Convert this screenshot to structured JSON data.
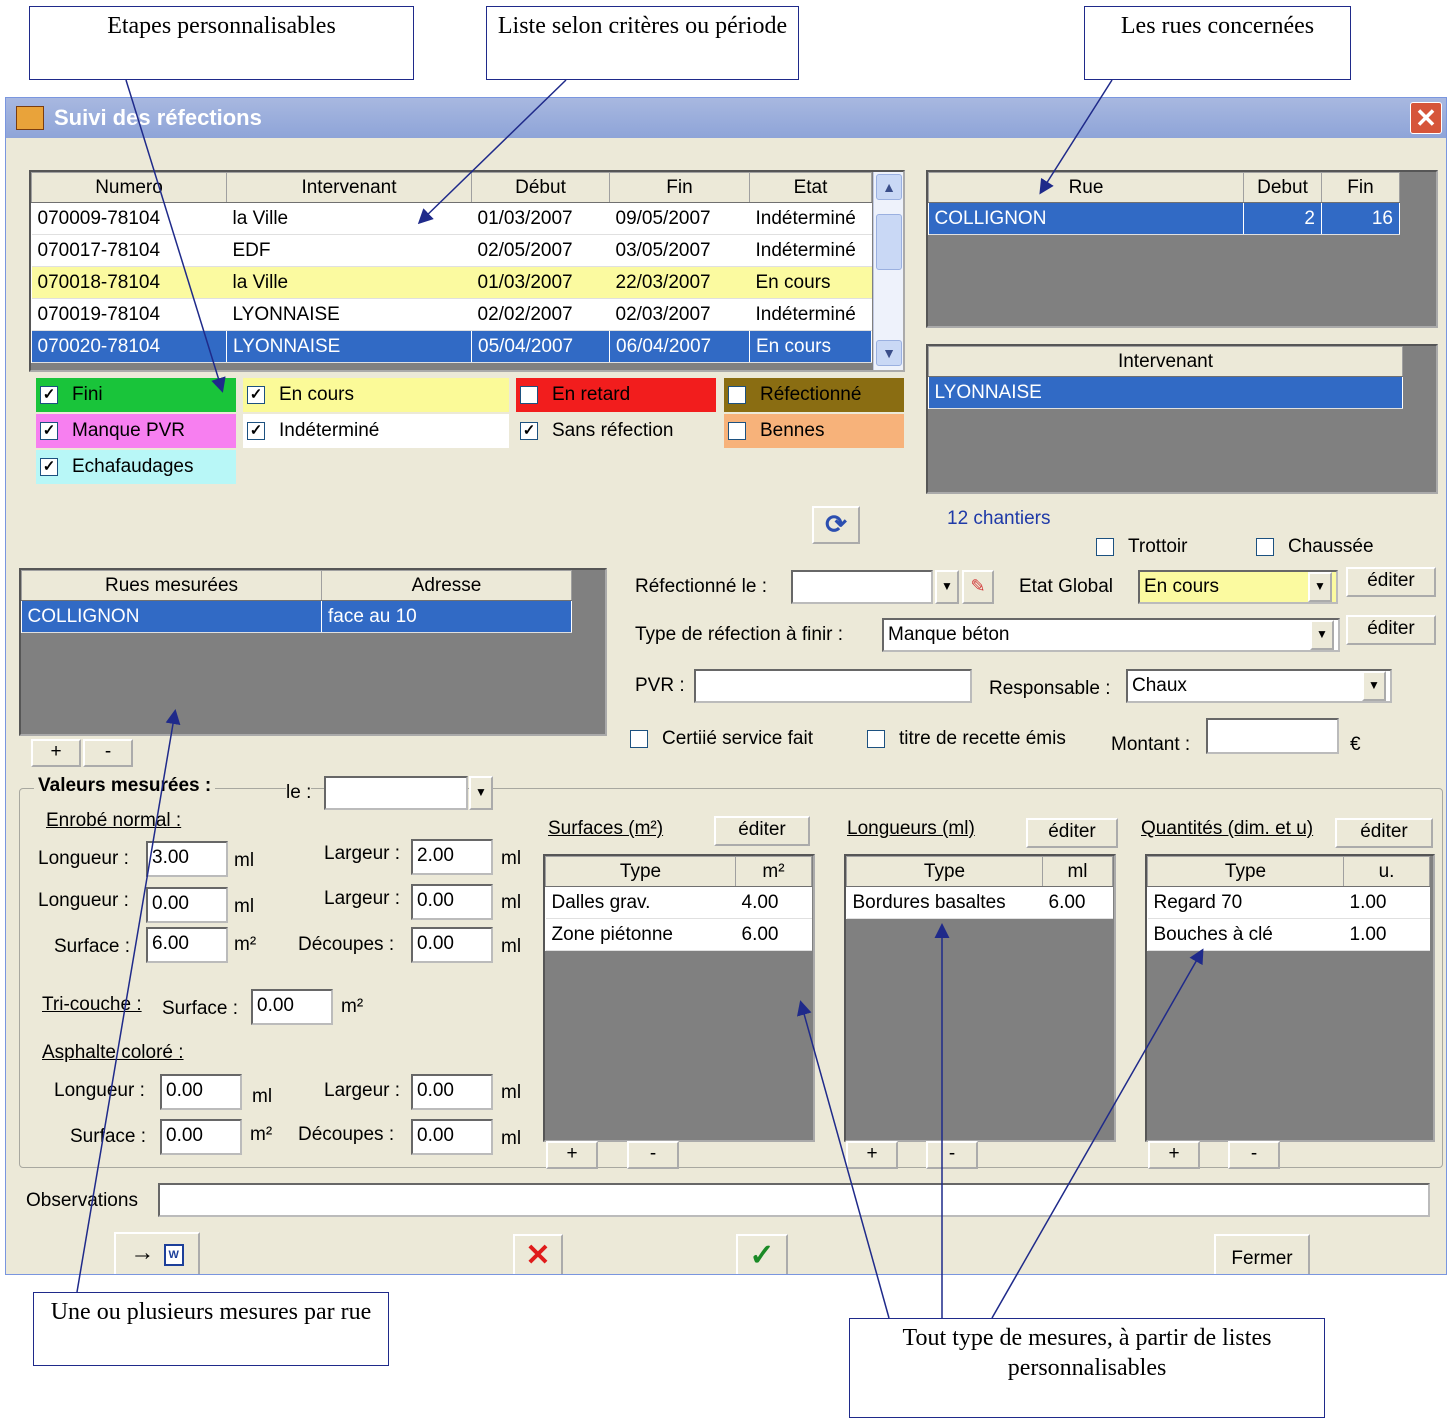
{
  "callouts": {
    "etapes": "Etapes personnalisables",
    "liste": "Liste selon critères ou période",
    "rues": "Les rues concernées",
    "mesures_rue": "Une ou plusieurs mesures par rue",
    "tout_type": "Tout type de mesures, à partir de listes personnalisables"
  },
  "window": {
    "title": "Suivi des réfections",
    "close": "✕"
  },
  "chantiers_table": {
    "columns": [
      "Numero",
      "Intervenant",
      "Début",
      "Fin",
      "Etat"
    ],
    "rows": [
      [
        "070009-78104",
        "la Ville",
        "01/03/2007",
        "09/05/2007",
        "Indéterminé"
      ],
      [
        "070017-78104",
        "EDF",
        "02/05/2007",
        "03/05/2007",
        "Indéterminé"
      ],
      [
        "070018-78104",
        "la Ville",
        "01/03/2007",
        "22/03/2007",
        "En cours"
      ],
      [
        "070019-78104",
        "LYONNAISE",
        "02/02/2007",
        "02/03/2007",
        "Indéterminé"
      ],
      [
        "070020-78104",
        "LYONNAISE",
        "05/04/2007",
        "06/04/2007",
        "En cours"
      ]
    ]
  },
  "rue_table": {
    "columns": [
      "Rue",
      "Debut",
      "Fin"
    ],
    "rows": [
      [
        "COLLIGNON",
        "2",
        "16"
      ]
    ]
  },
  "intervenant_table": {
    "columns": [
      "Intervenant"
    ],
    "rows": [
      [
        "LYONNAISE"
      ]
    ]
  },
  "filters": [
    {
      "label": "Fini",
      "checked": true,
      "color": "#19c43a"
    },
    {
      "label": "En cours",
      "checked": true,
      "color": "#fbfa98"
    },
    {
      "label": "En retard",
      "checked": false,
      "color": "#f21d1d"
    },
    {
      "label": "Réfectionné",
      "checked": false,
      "color": "#8a6d12"
    },
    {
      "label": "Manque PVR",
      "checked": true,
      "color": "#f77ff0"
    },
    {
      "label": "Indéterminé",
      "checked": true,
      "color": "#ffffff"
    },
    {
      "label": "Sans réfection",
      "checked": true,
      "color": "#ece9d8"
    },
    {
      "label": "Bennes",
      "checked": false,
      "color": "#f7b27a"
    },
    {
      "label": "Echafaudages",
      "checked": true,
      "color": "#b8f7f7"
    }
  ],
  "chantiers_count": "12 chantiers",
  "trottoir": "Trottoir",
  "chaussee": "Chaussée",
  "mesures_table": {
    "columns": [
      "Rues mesurées",
      "Adresse"
    ],
    "rows": [
      [
        "COLLIGNON",
        "face au 10"
      ]
    ]
  },
  "form": {
    "refectionne_le": "Réfectionné le :",
    "etat_global": "Etat Global",
    "etat_global_value": "En cours",
    "editer": "éditer",
    "type_refection": "Type de réfection à finir :",
    "type_refection_value": "Manque béton",
    "pvr": "PVR :",
    "responsable": "Responsable :",
    "responsable_value": "Chaux",
    "certifie": "Certiié service fait",
    "titre_recette": "titre de recette émis",
    "montant": "Montant :",
    "euro": "€"
  },
  "plus": "+",
  "minus": "-",
  "valeurs": {
    "title": "Valeurs mesurées :",
    "le": "le :",
    "enrobe": "Enrobé normal :",
    "longueur": "Longueur :",
    "largeur": "Largeur :",
    "surface": "Surface :",
    "decoupes": "Découpes :",
    "ml": "ml",
    "m2": "m²",
    "enrobe_l1": "3.00",
    "enrobe_w1": "2.00",
    "enrobe_l2": "0.00",
    "enrobe_w2": "0.00",
    "enrobe_s": "6.00",
    "enrobe_d": "0.00",
    "tricouche": "Tri-couche :",
    "tricouche_s": "0.00",
    "asphalte": "Asphalte coloré :",
    "asph_l": "0.00",
    "asph_w": "0.00",
    "asph_s": "0.00",
    "asph_d": "0.00"
  },
  "surfaces": {
    "title": "Surfaces (m²)",
    "columns": [
      "Type",
      "m²"
    ],
    "rows": [
      [
        "Dalles grav.",
        "4.00"
      ],
      [
        "Zone piétonne",
        "6.00"
      ]
    ]
  },
  "longueurs": {
    "title": "Longueurs (ml)",
    "columns": [
      "Type",
      "ml"
    ],
    "rows": [
      [
        "Bordures basaltes",
        "6.00"
      ]
    ]
  },
  "quantites": {
    "title": "Quantités (dim. et u)",
    "columns": [
      "Type",
      "u."
    ],
    "rows": [
      [
        "Regard 70",
        "1.00"
      ],
      [
        "Bouches à clé",
        "1.00"
      ]
    ]
  },
  "observations": "Observations",
  "bottom": {
    "export_arrow": "→",
    "fermer": "Fermer"
  }
}
